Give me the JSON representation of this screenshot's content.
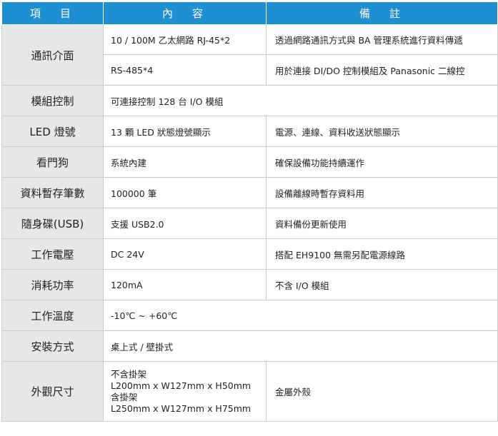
{
  "header": {
    "item": "項　目",
    "content": "內　容",
    "note": "備　註"
  },
  "rows": [
    {
      "label": "通訊介面",
      "content": "10 / 100M 乙太網路 RJ-45*2",
      "note": "透過網路通訊方式與 BA 管理系統進行資料傳遞"
    },
    {
      "content": "RS-485*4",
      "note": "用於連接 DI/DO 控制模組及 Panasonic 二線控"
    },
    {
      "label": "模組控制",
      "content": "可連接控制 128 台 I/O 模組"
    },
    {
      "label": "LED 燈號",
      "content": "13 顆 LED 狀態燈號顯示",
      "note": "電源、連線、資料收送狀態顯示"
    },
    {
      "label": "看門狗",
      "content": "系統內建",
      "note": "確保設備功能持續運作"
    },
    {
      "label": "資料暫存筆數",
      "content": "100000  筆",
      "note": "設備離線時暫存資料用"
    },
    {
      "label": "隨身碟(USB)",
      "content": "支援 USB2.0",
      "note": "資料備份更新使用"
    },
    {
      "label": "工作電壓",
      "content": "DC 24V",
      "note": "搭配 EH9100 無需另配電源線路"
    },
    {
      "label": "消耗功率",
      "content": "120mA",
      "note": "不含 I/O 模組"
    },
    {
      "label": "工作溫度",
      "content": "-10℃ ~ +60℃"
    },
    {
      "label": "安裝方式",
      "content": "桌上式 / 壁掛式"
    },
    {
      "label": "外觀尺寸",
      "content_lines": [
        "不含掛架",
        "L200mm x W127mm x H50mm",
        "含掛架",
        "L250mm x W127mm x H75mm"
      ],
      "note": "金屬外殼"
    }
  ]
}
